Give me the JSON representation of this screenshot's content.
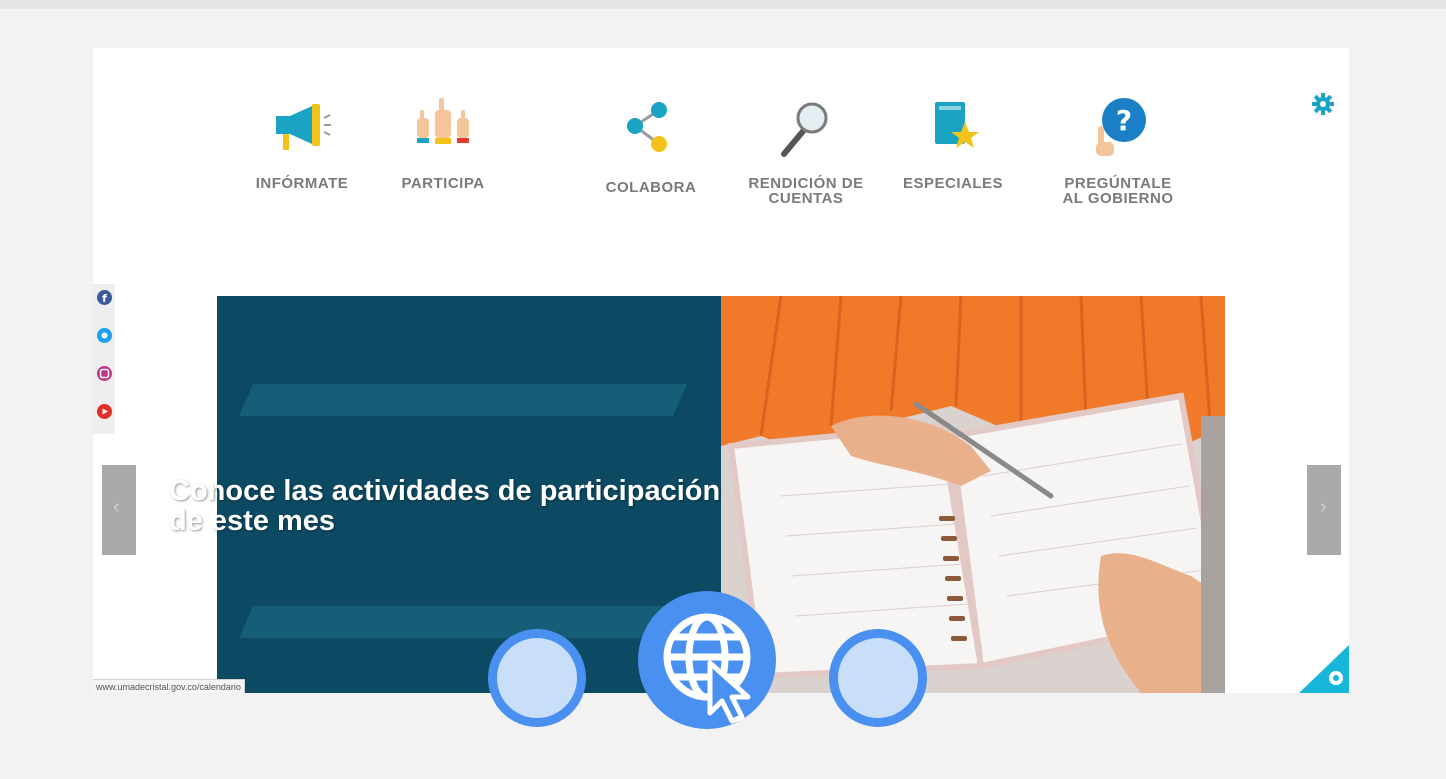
{
  "nav": [
    {
      "label": "INFÓRMATE",
      "icon": "megaphone-icon"
    },
    {
      "label": "PARTICIPA",
      "icon": "raised-hands-icon"
    },
    {
      "label": "COLABORA",
      "icon": "share-nodes-icon"
    },
    {
      "label": "RENDICIÓN DE\nCUENTAS",
      "icon": "magnifier-icon"
    },
    {
      "label": "ESPECIALES",
      "icon": "book-star-icon"
    },
    {
      "label": "PREGÚNTALE\nAL GOBIERNO",
      "icon": "question-hand-icon"
    }
  ],
  "settings_icon": "gear-icon",
  "social": [
    {
      "name": "facebook-icon",
      "color": "#3b5998"
    },
    {
      "name": "twitter-icon",
      "color": "#1da1f2"
    },
    {
      "name": "instagram-icon",
      "color": "#c13584"
    },
    {
      "name": "youtube-icon",
      "color": "#e52d27"
    }
  ],
  "slide": {
    "title_line1": "Conoce las actividades de participación",
    "title_line2": "de este mes"
  },
  "status_url": "www.umadecristal.gov.co/calendario",
  "colors": {
    "slide_bg": "#0c4a63",
    "sweater": "#f07a2a",
    "overlay_blue": "#4a90f0",
    "overlay_light": "#c9def9",
    "corner_teal": "#18b6d8"
  },
  "overlay": {
    "center_icon": "globe-cursor-icon"
  }
}
